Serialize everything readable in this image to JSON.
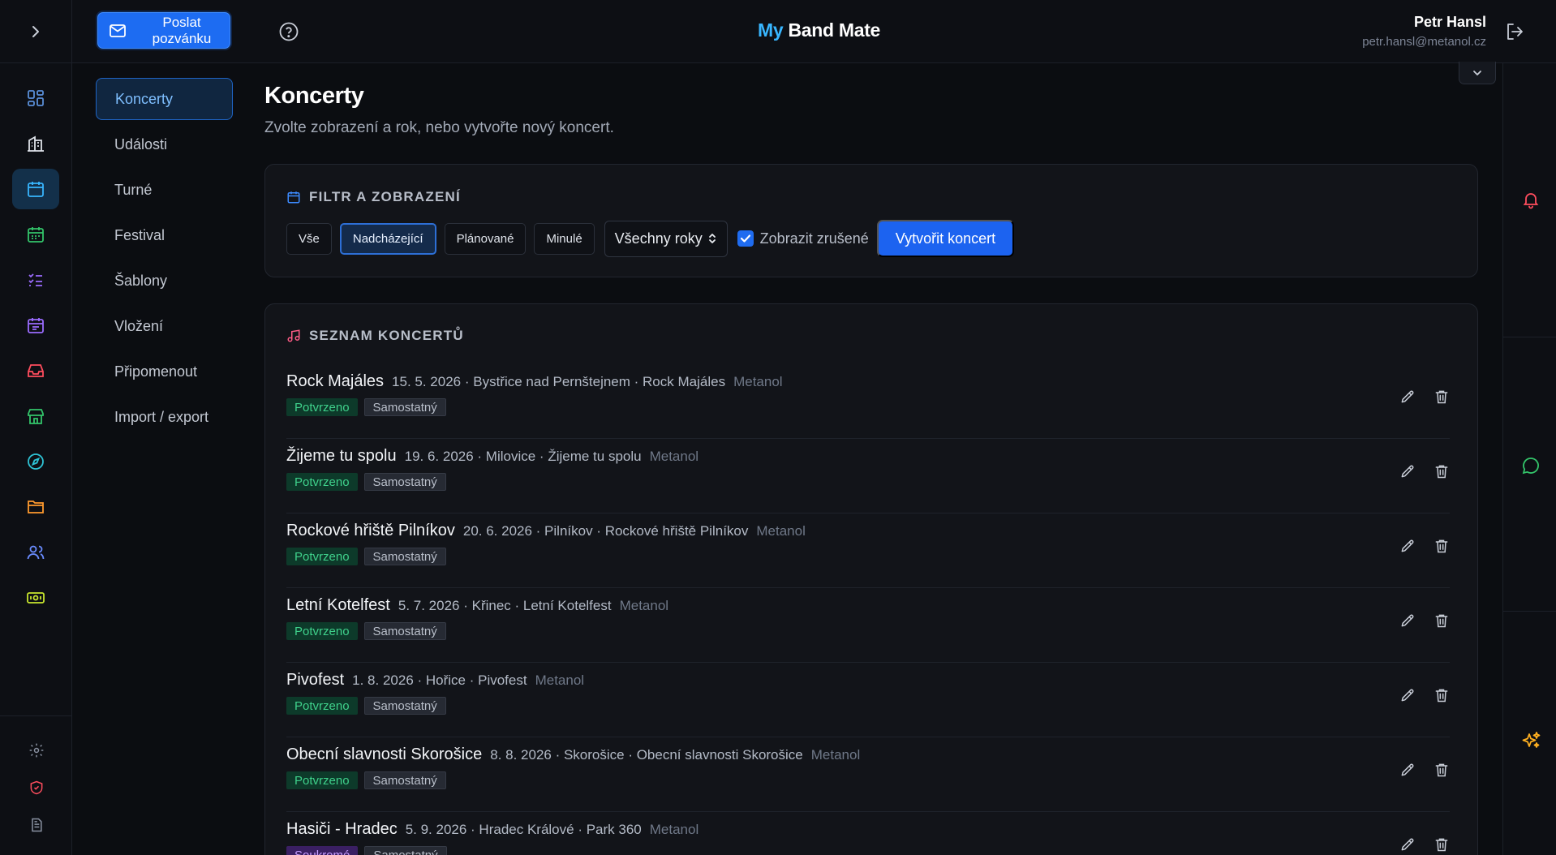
{
  "header": {
    "invite_label": "Poslat pozvánku",
    "brand_my": "My",
    "brand_rest": " Band Mate",
    "user_name": "Petr Hansl",
    "user_email": "petr.hansl@metanol.cz"
  },
  "rail": {
    "icons": [
      "dashboard-icon",
      "building-icon",
      "calendar-icon",
      "calendar-grid-icon",
      "checklist-icon",
      "calendar-event-icon",
      "inbox-icon",
      "store-icon",
      "compass-icon",
      "folder-icon",
      "users-icon",
      "money-icon"
    ],
    "bottom_icons": [
      "settings-icon",
      "shield-icon",
      "document-icon"
    ],
    "colors": {
      "active": "#38b6ff",
      "default": "#5a8fd8",
      "green": "#33c46a",
      "purple": "#9b6cff",
      "red": "#ff4d5e",
      "teal": "#2ec4d6",
      "orange": "#ff9a2e",
      "yellow": "#c8e62e"
    }
  },
  "subnav": {
    "items": [
      {
        "label": "Koncerty",
        "active": true
      },
      {
        "label": "Události",
        "active": false
      },
      {
        "label": "Turné",
        "active": false
      },
      {
        "label": "Festival",
        "active": false
      },
      {
        "label": "Šablony",
        "active": false
      },
      {
        "label": "Vložení",
        "active": false
      },
      {
        "label": "Připomenout",
        "active": false
      },
      {
        "label": "Import / export",
        "active": false
      }
    ]
  },
  "main": {
    "title": "Koncerty",
    "subtitle": "Zvolte zobrazení a rok, nebo vytvořte nový koncert."
  },
  "filter": {
    "title": "FILTR A ZOBRAZENÍ",
    "buttons": [
      {
        "label": "Vše",
        "active": false
      },
      {
        "label": "Nadcházející",
        "active": true
      },
      {
        "label": "Plánované",
        "active": false
      },
      {
        "label": "Minulé",
        "active": false
      }
    ],
    "year_select": "Všechny roky",
    "show_cancelled_label": "Zobrazit zrušené",
    "show_cancelled_checked": true,
    "create_label": "Vytvořit koncert"
  },
  "list": {
    "title": "SEZNAM KONCERTŮ",
    "rows": [
      {
        "name": "Rock Majáles",
        "meta": "15. 5. 2026 · Bystřice nad Pernštejnem · Rock Majáles",
        "band": "Metanol",
        "status": "Potvrzeno",
        "status_color": "green",
        "type": "Samostatný"
      },
      {
        "name": "Žijeme tu spolu",
        "meta": "19. 6. 2026 · Milovice · Žijeme tu spolu",
        "band": "Metanol",
        "status": "Potvrzeno",
        "status_color": "green",
        "type": "Samostatný"
      },
      {
        "name": "Rockové hřiště Pilníkov",
        "meta": "20. 6. 2026 · Pilníkov · Rockové hřiště Pilníkov",
        "band": "Metanol",
        "status": "Potvrzeno",
        "status_color": "green",
        "type": "Samostatný"
      },
      {
        "name": "Letní Kotelfest",
        "meta": "5. 7. 2026 · Křinec · Letní Kotelfest",
        "band": "Metanol",
        "status": "Potvrzeno",
        "status_color": "green",
        "type": "Samostatný"
      },
      {
        "name": "Pivofest",
        "meta": "1. 8. 2026 · Hořice · Pivofest",
        "band": "Metanol",
        "status": "Potvrzeno",
        "status_color": "green",
        "type": "Samostatný"
      },
      {
        "name": "Obecní slavnosti Skorošice",
        "meta": "8. 8. 2026 · Skorošice · Obecní slavnosti Skorošice",
        "band": "Metanol",
        "status": "Potvrzeno",
        "status_color": "green",
        "type": "Samostatný"
      },
      {
        "name": "Hasiči - Hradec",
        "meta": "5. 9. 2026 · Hradec Králové · Park 360",
        "band": "Metanol",
        "status": "Soukromé",
        "status_color": "purple",
        "type": "Samostatný"
      }
    ]
  },
  "right_rail": {
    "icons": [
      "bell-icon",
      "chat-icon",
      "sparkles-icon"
    ]
  }
}
